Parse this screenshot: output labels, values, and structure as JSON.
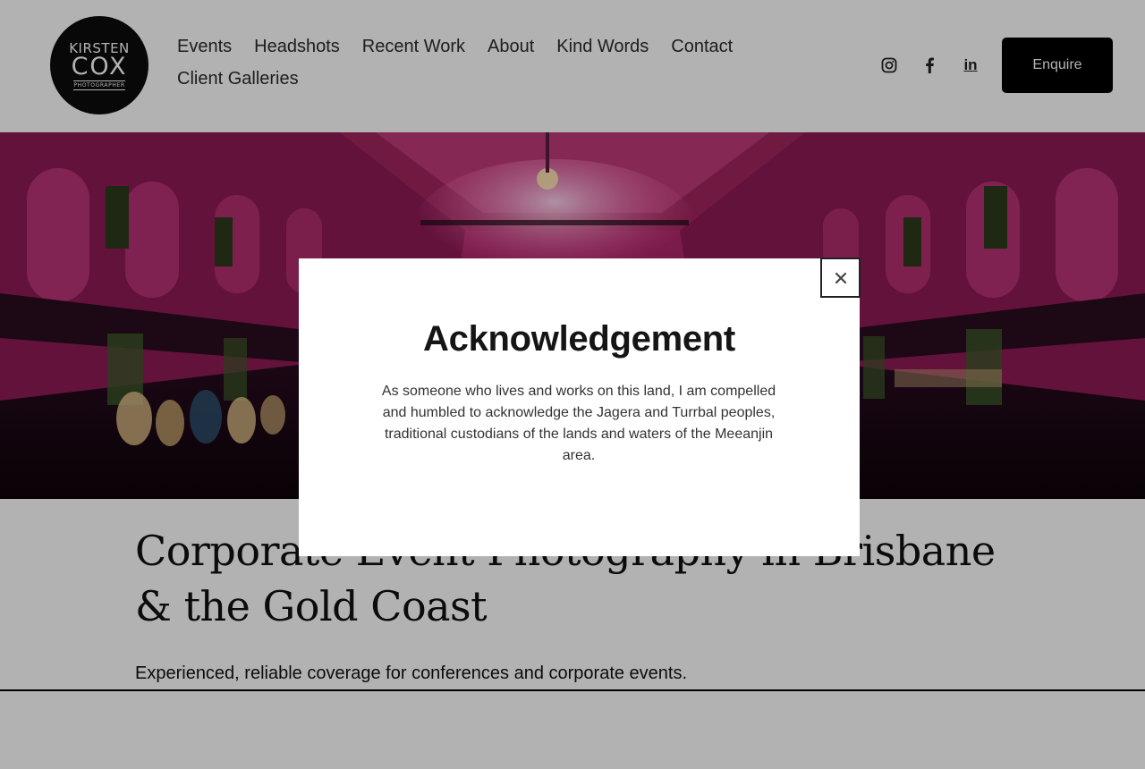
{
  "logo": {
    "line1": "KIRSTEN",
    "line2": "COX",
    "line3": "PHOTOGRAPHER"
  },
  "nav": {
    "items": [
      {
        "label": "Events"
      },
      {
        "label": "Headshots"
      },
      {
        "label": "Recent Work"
      },
      {
        "label": "About"
      },
      {
        "label": "Kind Words"
      },
      {
        "label": "Contact"
      },
      {
        "label": "Client Galleries"
      }
    ]
  },
  "social": {
    "icons": [
      "instagram-icon",
      "facebook-icon",
      "linkedin-icon"
    ],
    "linkedin_glyph": "in"
  },
  "header": {
    "enquire_label": "Enquire"
  },
  "content": {
    "headline": "Corporate Event Photography in Brisbane & the Gold Coast",
    "subline": "Experienced, reliable coverage for conferences and corporate events."
  },
  "modal": {
    "title": "Acknowledgement",
    "body": "As someone who lives and works on this land, I am compelled and humbled to acknowledge the Jagera and Turrbal peoples, traditional custodians of the lands and waters of the Meeanjin area.",
    "close_glyph": "×"
  },
  "colors": {
    "accent": "#000000",
    "hero_magenta": "#c2185b",
    "overlay": "rgba(0,0,0,0.3)"
  }
}
